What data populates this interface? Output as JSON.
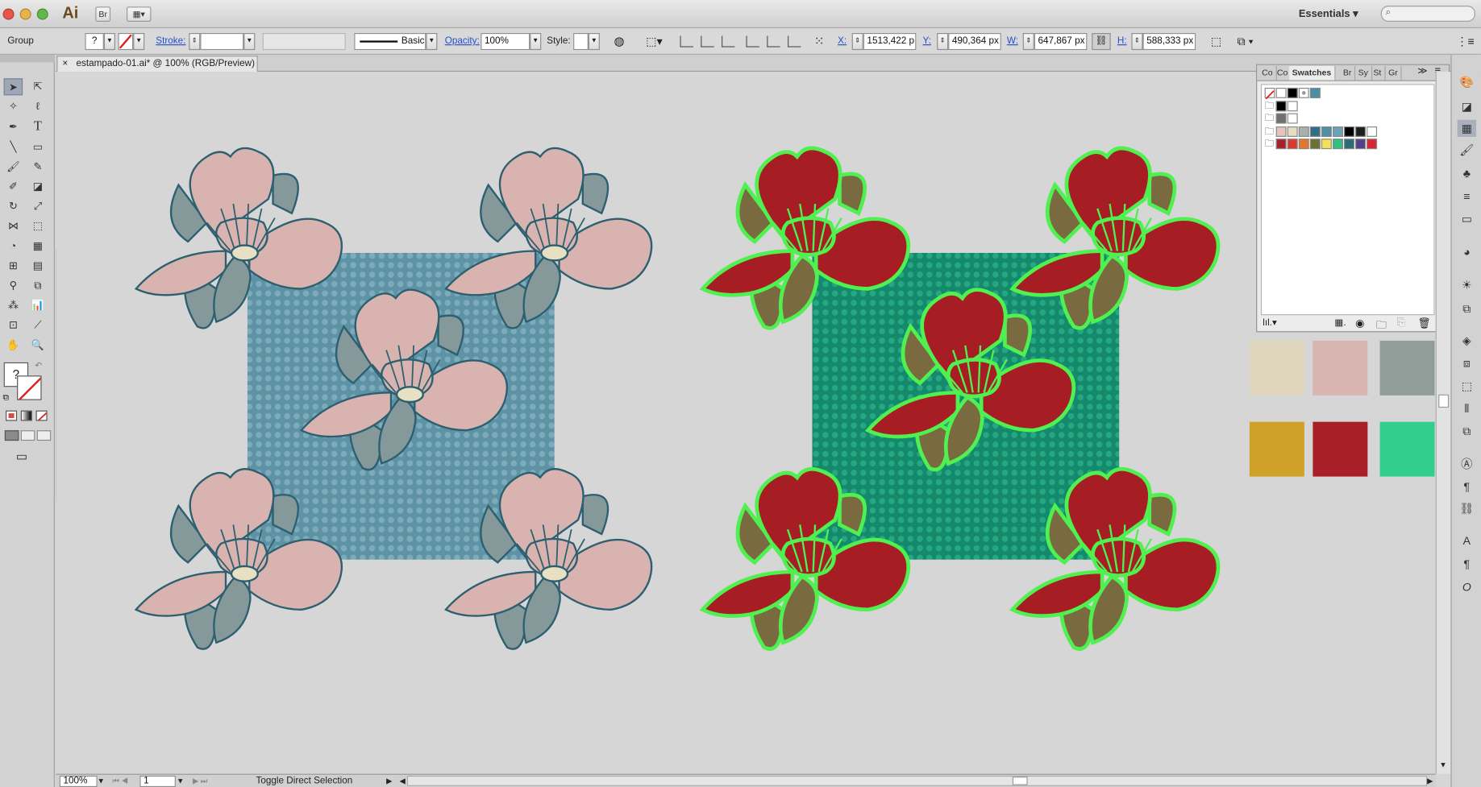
{
  "app": {
    "logo": "Ai",
    "bridge_label": "Br",
    "workspace": "Essentials ▾"
  },
  "control": {
    "selection_label": "Group",
    "stroke_label": "Stroke:",
    "brush_label": "Basic",
    "opacity_label": "Opacity:",
    "opacity_value": "100%",
    "style_label": "Style:",
    "x_label": "X:",
    "x_value": "1513,422 p",
    "y_label": "Y:",
    "y_value": "490,364 px",
    "w_label": "W:",
    "w_value": "647,867 px",
    "h_label": "H:",
    "h_value": "588,333 px",
    "unknown_fill": "?"
  },
  "document": {
    "tab_title": "estampado-01.ai* @ 100% (RGB/Preview)",
    "close_glyph": "×"
  },
  "status": {
    "zoom": "100%",
    "page": "1",
    "tool_message": "Toggle Direct Selection"
  },
  "toolbox": {
    "unknown_fill": "?"
  },
  "swatches_panel": {
    "tabs": [
      "Co",
      "Co",
      "Swatches",
      "Br",
      "Sy",
      "St",
      "Gr"
    ],
    "active_tab": "Swatches",
    "rows": [
      {
        "colors": [
          "none",
          "#ffffff",
          "#000000",
          "pattern",
          "#4a8ea0"
        ]
      },
      {
        "colors": [
          "#000000",
          "#ffffff"
        ]
      },
      {
        "colors": [
          "#707070",
          "#ffffff"
        ]
      },
      {
        "colors": [
          "#e7c3c0",
          "#e6ddc3",
          "#a6b3ad",
          "#2f6f86",
          "#4e8fa2",
          "#6aa3b6",
          "#000000",
          "#1d1d1d",
          "#ffffff"
        ]
      },
      {
        "colors": [
          "#a8202a",
          "#d83a2e",
          "#e2772e",
          "#6d7232",
          "#f1e35a",
          "#2fbf84",
          "#2b6b78",
          "#533e8c",
          "#d72536"
        ]
      }
    ]
  },
  "palette": {
    "swatches": [
      "#dfd5bd",
      "#d9b5b2",
      "#919d98",
      "#cfa126",
      "#a81f27",
      "#31cf8b"
    ]
  },
  "artwork": {
    "left_background": "#5e93a6",
    "left_petal": "#d8b3b0",
    "left_leaf": "#86999a",
    "left_outline": "#2c5f6f",
    "right_background": "#14896b",
    "right_petal": "#a61d24",
    "right_leaf": "#7a6a3f",
    "right_outline": "#4ff04f"
  }
}
